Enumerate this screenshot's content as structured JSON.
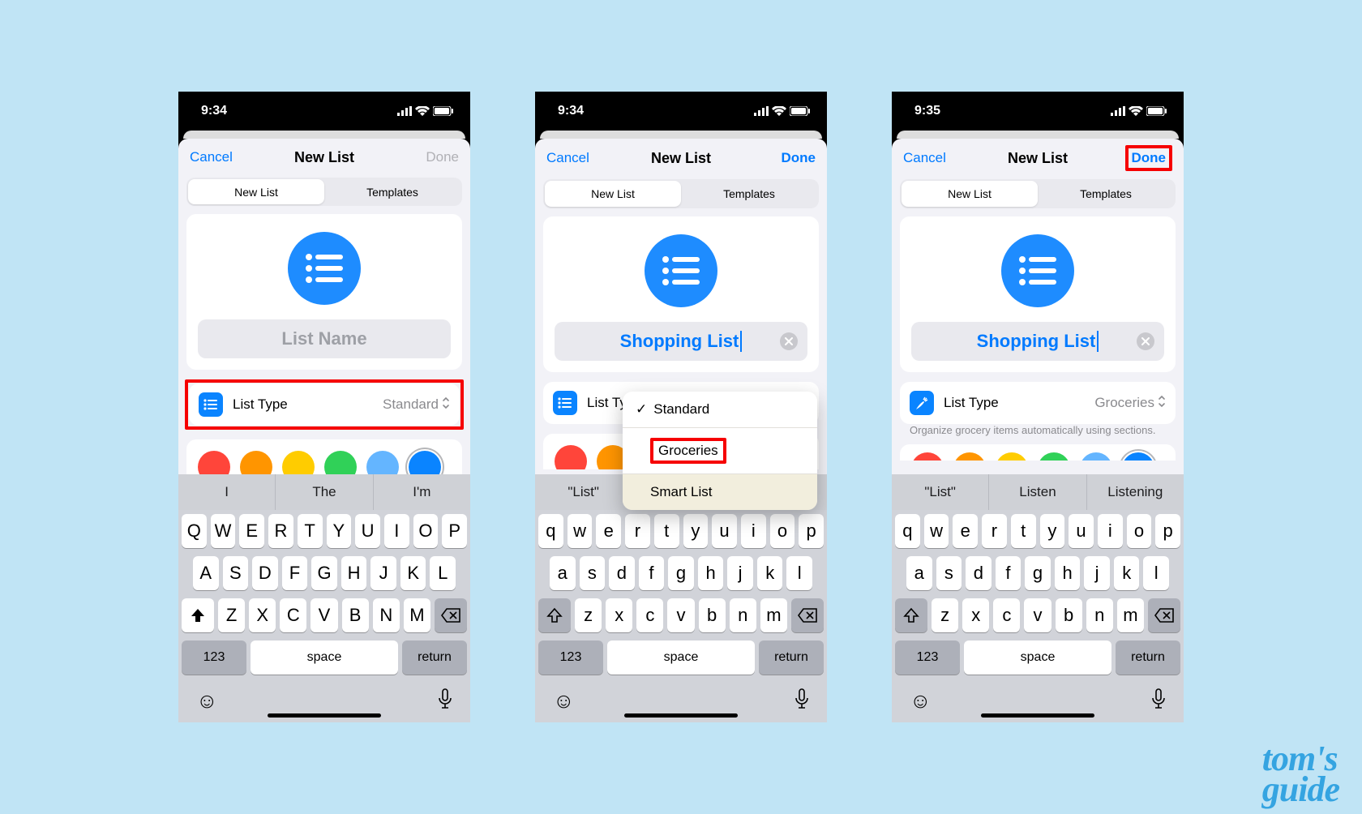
{
  "screens": [
    {
      "time": "9:34",
      "cancel": "Cancel",
      "title": "New List",
      "done": "Done",
      "done_enabled": false,
      "seg": [
        "New List",
        "Templates"
      ],
      "name_placeholder": "List Name",
      "name_value": "",
      "list_type_label": "List Type",
      "list_type_value": "Standard",
      "list_type_icon_color": "#0a84ff",
      "colors": [
        "#ff453a",
        "#ff9500",
        "#ffcc00",
        "#30d158",
        "#64b5ff",
        "#0a84ff"
      ],
      "selected_color_index": 5,
      "predictions": [
        "I",
        "The",
        "I'm"
      ],
      "keyboard_case": "upper",
      "key_rows": [
        [
          "Q",
          "W",
          "E",
          "R",
          "T",
          "Y",
          "U",
          "I",
          "O",
          "P"
        ],
        [
          "A",
          "S",
          "D",
          "F",
          "G",
          "H",
          "J",
          "K",
          "L"
        ],
        [
          "Z",
          "X",
          "C",
          "V",
          "B",
          "N",
          "M"
        ]
      ],
      "key123": "123",
      "space": "space",
      "return": "return",
      "highlight_list_type": true
    },
    {
      "time": "9:34",
      "cancel": "Cancel",
      "title": "New List",
      "done": "Done",
      "done_enabled": true,
      "seg": [
        "New List",
        "Templates"
      ],
      "name_value": "Shopping List",
      "list_type_label": "List Ty",
      "list_type_icon_color": "#0a84ff",
      "popup": [
        "Standard",
        "Groceries",
        "Smart List"
      ],
      "popup_checked_index": 0,
      "popup_highlight_index": 1,
      "colors": [
        "#ff453a",
        "#ff9500",
        "#ffcc00",
        "#30d158",
        "#64b5ff",
        "#0a84ff"
      ],
      "selected_color_index": 5,
      "predictions": [
        "\"List\"",
        "Listen",
        "Listening"
      ],
      "keyboard_case": "lower",
      "key_rows": [
        [
          "q",
          "w",
          "e",
          "r",
          "t",
          "y",
          "u",
          "i",
          "o",
          "p"
        ],
        [
          "a",
          "s",
          "d",
          "f",
          "g",
          "h",
          "j",
          "k",
          "l"
        ],
        [
          "z",
          "x",
          "c",
          "v",
          "b",
          "n",
          "m"
        ]
      ],
      "key123": "123",
      "space": "space",
      "return": "return"
    },
    {
      "time": "9:35",
      "cancel": "Cancel",
      "title": "New List",
      "done": "Done",
      "done_enabled": true,
      "done_highlight": true,
      "seg": [
        "New List",
        "Templates"
      ],
      "name_value": "Shopping List",
      "list_type_label": "List Type",
      "list_type_value": "Groceries",
      "list_type_icon_color": "#0a84ff",
      "list_type_icon": "carrot",
      "subtitle": "Organize grocery items automatically using sections.",
      "colors": [
        "#ff453a",
        "#ff9500",
        "#ffcc00",
        "#30d158",
        "#64b5ff",
        "#0a84ff"
      ],
      "selected_color_index": 5,
      "predictions": [
        "\"List\"",
        "Listen",
        "Listening"
      ],
      "keyboard_case": "lower",
      "key_rows": [
        [
          "q",
          "w",
          "e",
          "r",
          "t",
          "y",
          "u",
          "i",
          "o",
          "p"
        ],
        [
          "a",
          "s",
          "d",
          "f",
          "g",
          "h",
          "j",
          "k",
          "l"
        ],
        [
          "z",
          "x",
          "c",
          "v",
          "b",
          "n",
          "m"
        ]
      ],
      "key123": "123",
      "space": "space",
      "return": "return"
    }
  ],
  "watermark": "tom's\nguide"
}
